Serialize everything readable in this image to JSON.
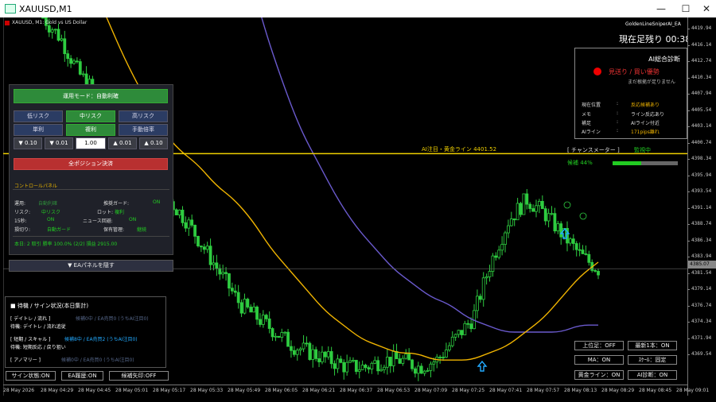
{
  "window": {
    "title": "XAUUSD,M1"
  },
  "chart_header": {
    "symbol_label": "XAUUSD, M1:  Gold vs US Dollar",
    "ea_name": "GoldenLineSniperAI_EA"
  },
  "countdown": "現在足残り 00:38",
  "price_axis": {
    "ticks": [
      "4419.94",
      "4416.14",
      "4412.74",
      "4410.34",
      "4407.94",
      "4405.54",
      "4403.14",
      "4400.74",
      "4398.34",
      "4395.94",
      "4393.54",
      "4391.14",
      "4388.74",
      "4386.34",
      "4383.94",
      "4381.54",
      "4379.14",
      "4376.74",
      "4374.34",
      "4371.94",
      "4369.54"
    ],
    "current_price": "4385.07"
  },
  "time_axis": {
    "ticks": [
      "28 May 2026",
      "28 May 04:29",
      "28 May 04:45",
      "28 May 05:01",
      "28 May 05:17",
      "28 May 05:33",
      "28 May 05:49",
      "28 May 06:05",
      "28 May 06:21",
      "28 May 06:37",
      "28 May 06:53",
      "28 May 07:09",
      "28 May 07:25",
      "28 May 07:41",
      "28 May 07:57",
      "28 May 08:13",
      "28 May 08:29",
      "28 May 08:45",
      "28 May 09:01"
    ]
  },
  "ai_panel": {
    "title": "AI総合診断",
    "verdict": "見送り / 買い優勢",
    "sub": "まだ根拠が足りません",
    "rows": [
      {
        "k": "現在位置",
        "c": ":",
        "v": "反応候補あり",
        "color": "#f0b400"
      },
      {
        "k": "メモ",
        "c": ":",
        "v": "ライン反応あり",
        "color": "#dddddd"
      },
      {
        "k": "補足",
        "c": ":",
        "v": "AIライン付近",
        "color": "#dddddd"
      },
      {
        "k": "AIライン",
        "c": ":",
        "v": "171pips離れ",
        "color": "#f0b400"
      }
    ]
  },
  "gold_line": {
    "label": "AI注目・黄金ライン 4401.52",
    "color": "#f0d000"
  },
  "meter": {
    "label": "[ チャンスメーター ]",
    "status": "監視中",
    "kouho": "候補  44%",
    "level": 0.44
  },
  "control": {
    "mode_button": "運用モード：自動利確",
    "risk_buttons": [
      "低リスク",
      "中リスク",
      "高リスク"
    ],
    "lot_buttons": [
      "単利",
      "複利",
      "手動倍率"
    ],
    "steps": [
      "▼ 0.10",
      "▼ 0.01",
      "1.00",
      "▲ 0.01",
      "▲ 0.10"
    ],
    "close_all": "全ポジション決済",
    "panel_title": "コントロールパネル",
    "rows": [
      {
        "k": "運用:",
        "v": "自動利確",
        "k2": "推奨ガード:",
        "v2": "ON"
      },
      {
        "k": "リスク:",
        "v": "中リスク",
        "k2": "ロット:",
        "v2": "複利"
      },
      {
        "k": "15秒:",
        "v": "ON",
        "k2": "ニュース回避:",
        "v2": "ON"
      },
      {
        "k": "損切り:",
        "v": "自動ガード",
        "k2": "保有管理:",
        "v2": "継続"
      }
    ],
    "stats": "本日: 2 取引  勝率 100.0% (2/2)  損益 2915.00",
    "hide_button": "▼ EAパネルを隠す"
  },
  "signal": {
    "title": "■ 待機 / サイン状況(本日集計)",
    "lines": [
      {
        "t": "[ デイトレ / 流れ ]",
        "r": "候補0中 / EA売買0 (うちAI注目0)",
        "rc": "#556688"
      },
      {
        "t": "待機: デイトレ / 流れ追従",
        "r": "",
        "rc": "#ffffff"
      },
      {
        "t": "[ 短期 / スキャル ]",
        "r": "候補8中 / EA売買2 (うちAI注目0)",
        "rc": "#22aaff"
      },
      {
        "t": "待機: 短期反応 / 戻り狙い",
        "r": "",
        "rc": "#ffffff"
      },
      {
        "t": "[ アノマリー ]",
        "r": "候補0中 / EA売買0 (うちAI注目0)",
        "rc": "#556688"
      }
    ]
  },
  "bottom_left": [
    "サイン状態:ON",
    "EA履歴:ON",
    "候補矢印:OFF"
  ],
  "right_buttons": [
    "上位足：OFF",
    "最新1本：ON",
    "MA：ON",
    "ｽｹｰﾙ：固定",
    "黄金ライン：ON",
    "AI診断：ON"
  ],
  "chart_data": {
    "type": "candlestick",
    "symbol": "XAUUSD",
    "timeframe": "M1",
    "ylim": [
      4368.5,
      4421.0
    ],
    "gold_line": 4401.52,
    "current_price": 4385.07,
    "close_path": [
      4421,
      4418,
      4413,
      4410,
      4406,
      4402,
      4397,
      4395,
      4392,
      4388,
      4384,
      4380,
      4378,
      4376,
      4374,
      4373,
      4372,
      4371,
      4371,
      4372,
      4372,
      4371,
      4372,
      4375,
      4378,
      4386,
      4392,
      4395,
      4393,
      4390,
      4387,
      4385
    ],
    "ma_fast": [
      4421,
      4415,
      4410,
      4405,
      4402,
      4400,
      4397,
      4395,
      4392,
      4388,
      4385,
      4382,
      4379,
      4377,
      4375,
      4374,
      4373,
      4373,
      4372,
      4372,
      4372,
      4373,
      4374,
      4376,
      4378,
      4381,
      4384,
      4386
    ],
    "ma_slow": [
      4440,
      4430,
      4420,
      4412,
      4405,
      4400,
      4395,
      4391,
      4388,
      4385,
      4383,
      4381,
      4380,
      4378,
      4377,
      4376,
      4376,
      4376,
      4376,
      4377,
      4377
    ]
  }
}
